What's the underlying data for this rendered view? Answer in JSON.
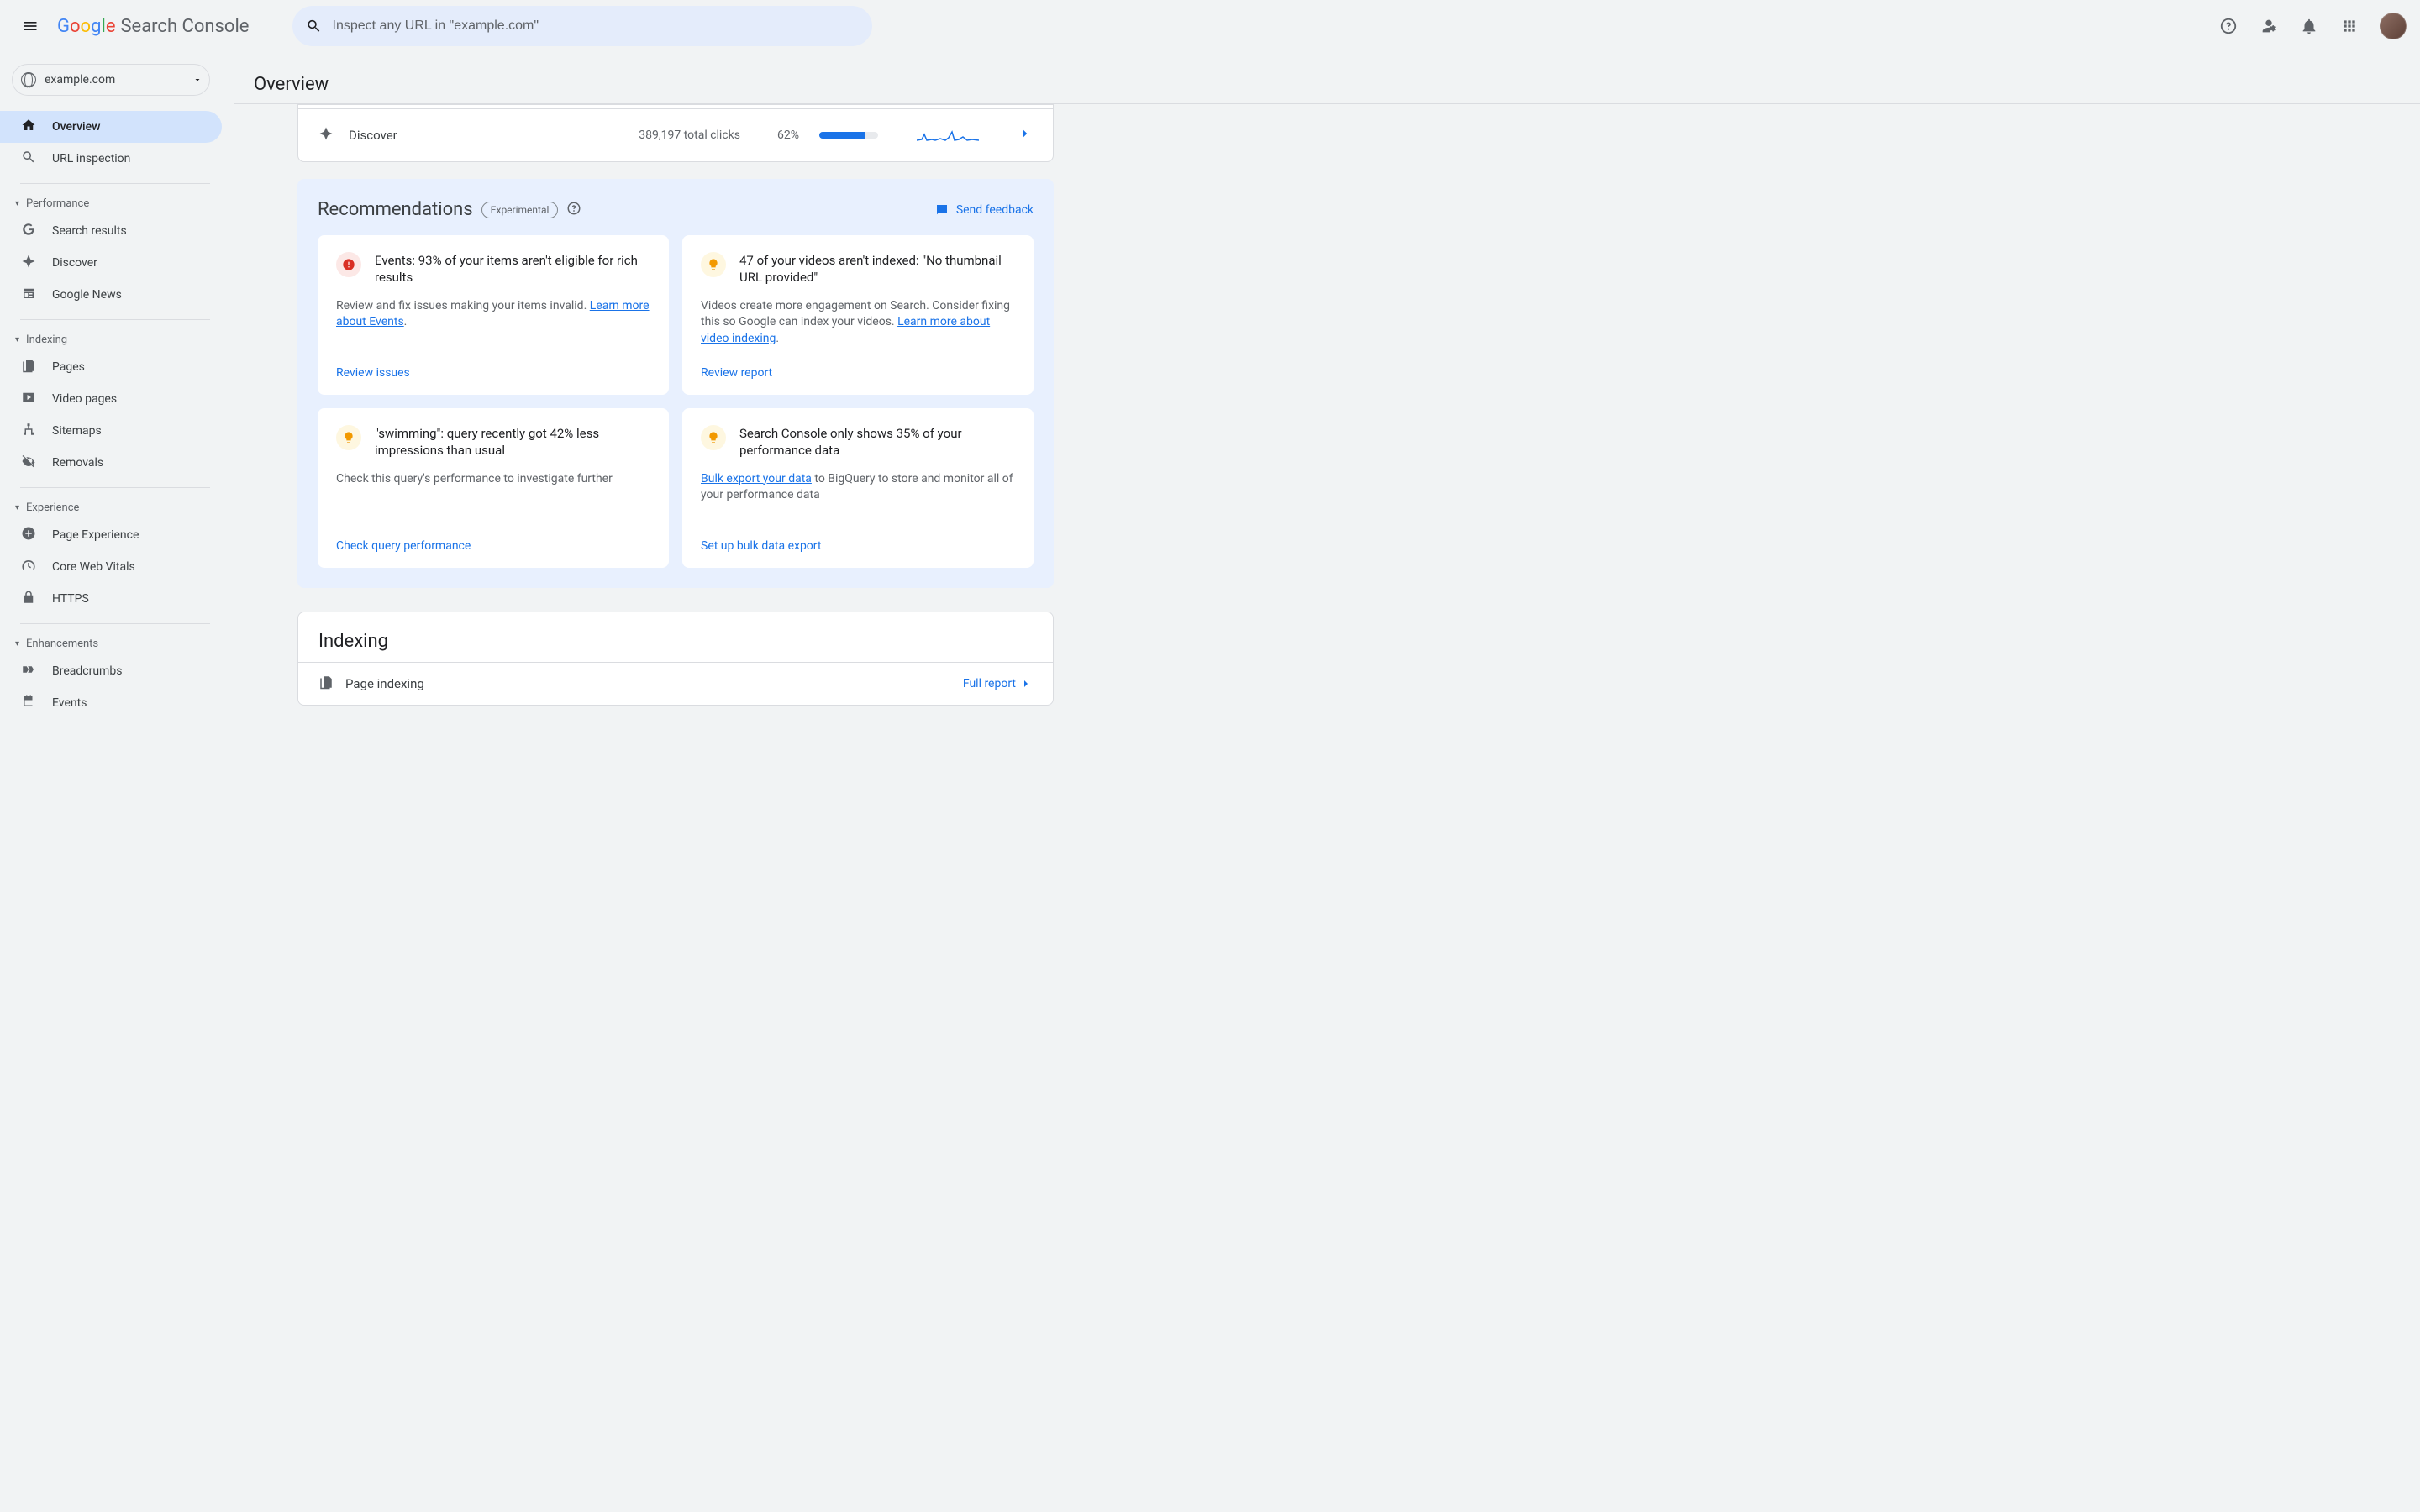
{
  "app": {
    "logo_text": "Search Console",
    "search_placeholder": "Inspect any URL in \"example.com\""
  },
  "property": {
    "name": "example.com"
  },
  "page_title": "Overview",
  "sidebar": {
    "main": [
      {
        "label": "Overview",
        "active": true
      },
      {
        "label": "URL inspection"
      }
    ],
    "groups": [
      {
        "title": "Performance",
        "items": [
          {
            "label": "Search results"
          },
          {
            "label": "Discover"
          },
          {
            "label": "Google News"
          }
        ]
      },
      {
        "title": "Indexing",
        "items": [
          {
            "label": "Pages"
          },
          {
            "label": "Video pages"
          },
          {
            "label": "Sitemaps"
          },
          {
            "label": "Removals"
          }
        ]
      },
      {
        "title": "Experience",
        "items": [
          {
            "label": "Page Experience"
          },
          {
            "label": "Core Web Vitals"
          },
          {
            "label": "HTTPS"
          }
        ]
      },
      {
        "title": "Enhancements",
        "items": [
          {
            "label": "Breadcrumbs"
          },
          {
            "label": "Events"
          }
        ]
      }
    ]
  },
  "discover": {
    "label": "Discover",
    "metric": "389,197 total clicks",
    "percent_label": "62%",
    "percent": 78
  },
  "recommendations": {
    "title": "Recommendations",
    "badge": "Experimental",
    "feedback_label": "Send feedback",
    "cards": [
      {
        "kind": "warn",
        "title": "Events: 93% of your items aren't eligible for rich results",
        "body_pre": "Review and fix issues making your items invalid. ",
        "link_text": "Learn more about Events",
        "body_post": ".",
        "action": "Review issues"
      },
      {
        "kind": "tip",
        "title": "47 of your videos aren't indexed: \"No thumbnail URL provided\"",
        "body_pre": "Videos create more engagement on Search. Consider fixing this so Google can index your videos. ",
        "link_text": "Learn more about video indexing",
        "body_post": ".",
        "action": "Review report"
      },
      {
        "kind": "tip",
        "title": "\"swimming\": query recently got 42% less impressions than usual",
        "body_pre": "Check this query's performance to investigate further",
        "link_text": "",
        "body_post": "",
        "action": "Check query performance"
      },
      {
        "kind": "tip",
        "title": "Search Console only shows 35% of your performance data",
        "body_pre": "",
        "link_text": "Bulk export your data",
        "body_post": " to BigQuery to store and monitor all of your performance data",
        "action": "Set up bulk data export"
      }
    ]
  },
  "indexing_section": {
    "title": "Indexing",
    "row_label": "Page indexing",
    "full_report": "Full report"
  }
}
